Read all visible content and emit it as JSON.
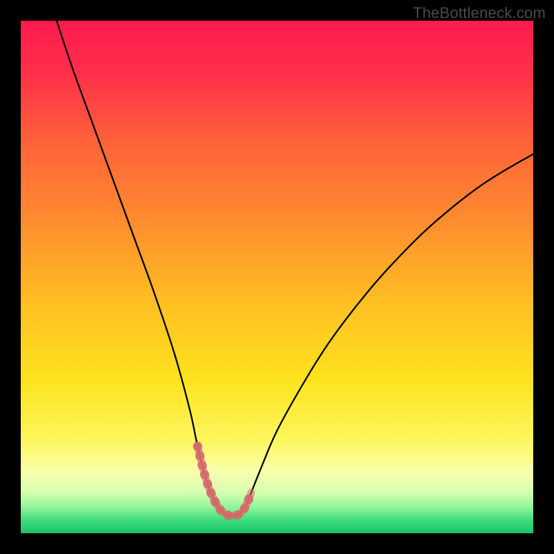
{
  "watermark": "TheBottleneck.com",
  "chart_data": {
    "type": "line",
    "title": "",
    "xlabel": "",
    "ylabel": "",
    "xlim": [
      0,
      100
    ],
    "ylim": [
      0,
      100
    ],
    "series": [
      {
        "name": "bottleneck-curve",
        "x": [
          7,
          10,
          14,
          18,
          22,
          26,
          30,
          33,
          34.5,
          36,
          37.5,
          39,
          40.5,
          42,
          43,
          44,
          45,
          47,
          50,
          55,
          60,
          66,
          72,
          80,
          90,
          100
        ],
        "y": [
          100,
          91,
          80,
          69,
          58,
          47,
          35,
          24,
          17,
          11,
          7,
          4.5,
          3.5,
          3.5,
          4,
          5.5,
          8,
          13,
          20,
          29,
          37,
          45,
          52,
          60,
          68,
          74
        ]
      }
    ],
    "highlight": {
      "name": "optimal-zone",
      "color": "#d66a6a",
      "x": [
        34.5,
        36,
        37.5,
        39,
        40.5,
        42,
        43,
        44,
        45
      ],
      "y": [
        17,
        11,
        7,
        4.5,
        3.5,
        3.5,
        4,
        5.5,
        8
      ]
    },
    "background_gradient": {
      "stops": [
        {
          "offset": 0.0,
          "color": "#ff1a4e"
        },
        {
          "offset": 0.1,
          "color": "#ff2f4a"
        },
        {
          "offset": 0.25,
          "color": "#ff6638"
        },
        {
          "offset": 0.4,
          "color": "#ff8f2e"
        },
        {
          "offset": 0.55,
          "color": "#ffbf22"
        },
        {
          "offset": 0.7,
          "color": "#fde31e"
        },
        {
          "offset": 0.82,
          "color": "#fdf65e"
        },
        {
          "offset": 0.88,
          "color": "#f8ffae"
        },
        {
          "offset": 0.92,
          "color": "#d6ffb0"
        },
        {
          "offset": 0.95,
          "color": "#8ef59a"
        },
        {
          "offset": 0.975,
          "color": "#3fdc7e"
        },
        {
          "offset": 1.0,
          "color": "#18c466"
        }
      ]
    }
  }
}
